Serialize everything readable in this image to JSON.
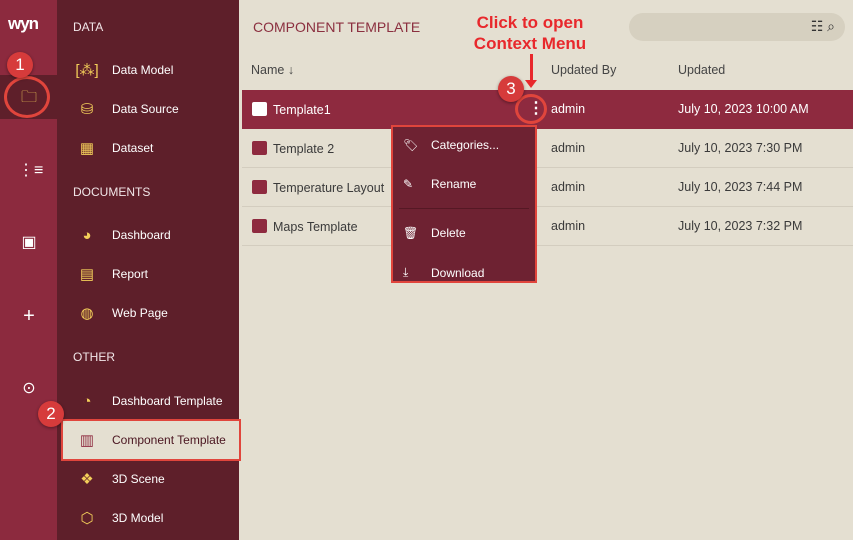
{
  "logo": "wyn",
  "sidebar": {
    "sections": [
      "DATA",
      "DOCUMENTS",
      "OTHER"
    ],
    "items": [
      {
        "label": "Data Model",
        "icon": "data-model-icon"
      },
      {
        "label": "Data Source",
        "icon": "database-icon"
      },
      {
        "label": "Dataset",
        "icon": "grid-icon"
      },
      {
        "label": "Dashboard",
        "icon": "pie-icon"
      },
      {
        "label": "Report",
        "icon": "document-icon"
      },
      {
        "label": "Web Page",
        "icon": "globe-icon"
      },
      {
        "label": "Dashboard Template",
        "icon": "dashboard-template-icon"
      },
      {
        "label": "Component Template",
        "icon": "component-template-icon"
      },
      {
        "label": "3D Scene",
        "icon": "cubes-icon"
      },
      {
        "label": "3D Model",
        "icon": "cube-icon"
      }
    ]
  },
  "main": {
    "title": "COMPONENT TEMPLATE",
    "columns": [
      "Name",
      "Updated By",
      "Updated"
    ],
    "rows": [
      {
        "name": "Template1",
        "by": "admin",
        "updated": "July 10, 2023 10:00 AM"
      },
      {
        "name": "Template 2",
        "by": "admin",
        "updated": "July 10, 2023 7:30 PM"
      },
      {
        "name": "Temperature Layout",
        "by": "admin",
        "updated": "July 10, 2023 7:44 PM"
      },
      {
        "name": "Maps Template",
        "by": "admin",
        "updated": "July 10, 2023 7:32 PM"
      }
    ]
  },
  "context_menu": [
    "Categories...",
    "Rename",
    "Delete",
    "Download"
  ],
  "annotation": {
    "line1": "Click to open",
    "line2": "Context Menu",
    "badges": [
      "1",
      "2",
      "3"
    ]
  }
}
